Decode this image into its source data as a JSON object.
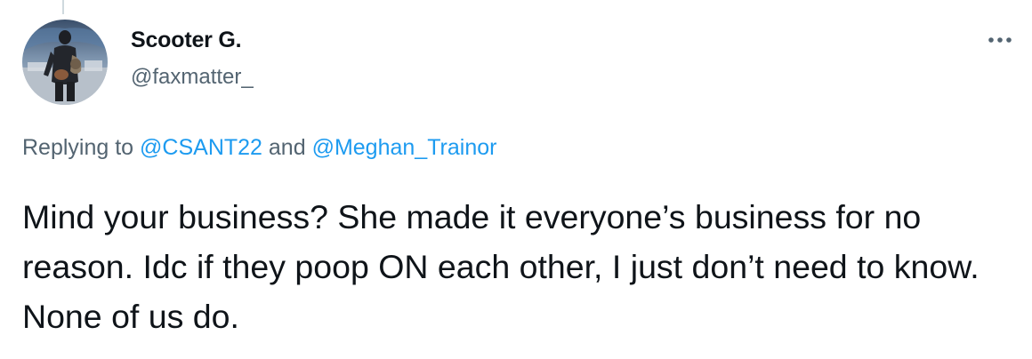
{
  "tweet": {
    "author": {
      "display_name": "Scooter G.",
      "handle": "@faxmatter_"
    },
    "reply_context": {
      "prefix": "Replying to",
      "mention_1": "@CSANT22",
      "conjunction": "and",
      "mention_2": "@Meghan_Trainor"
    },
    "text": "Mind your business? She made it everyone’s business for no reason. Idc if they poop ON each other, I just don’t need to know. None of us do."
  },
  "colors": {
    "primary_text": "#0f1419",
    "secondary_text": "#536471",
    "link": "#1d9bf0"
  },
  "icons": {
    "more": "more-horizontal-icon",
    "avatar": "user-avatar"
  }
}
